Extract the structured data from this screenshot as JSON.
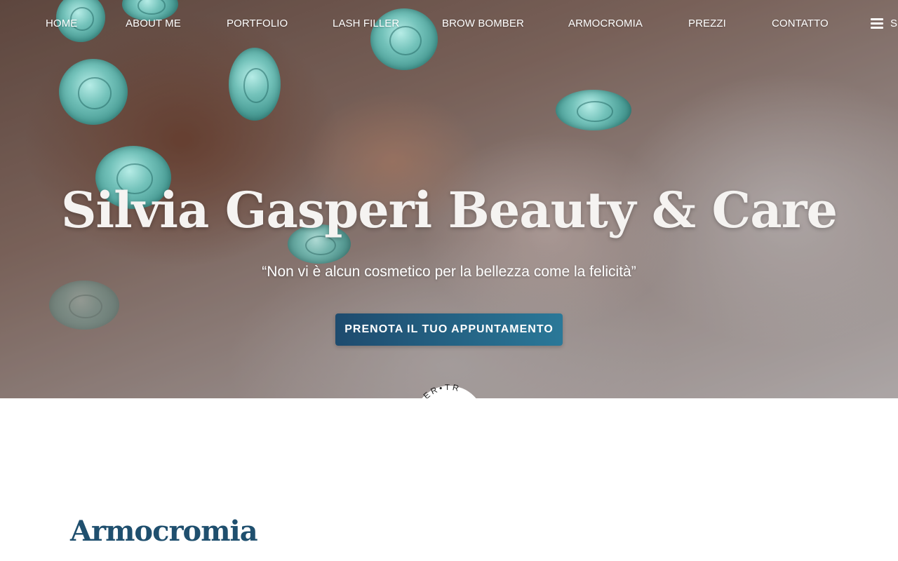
{
  "nav": {
    "items": [
      {
        "label": "HOME"
      },
      {
        "label": "ABOUT ME"
      },
      {
        "label": "PORTFOLIO"
      },
      {
        "label": "LASH FILLER"
      },
      {
        "label": "BROW BOMBER"
      },
      {
        "label": "ARMOCROMIA"
      },
      {
        "label": "PREZZI"
      },
      {
        "label": "CONTATTO"
      }
    ],
    "menu_icon": "hamburger-menu-icon",
    "menu_label": "S"
  },
  "hero": {
    "title": "Silvia Gasperi Beauty & Care",
    "quote": "“Non vi è alcun cosmetico per la bellezza come la felicità”",
    "cta_label": "PRENOTA IL TUO APPUNTAMENTO",
    "badge_text": "ER•TR",
    "colors": {
      "cta_start": "#1e4b6e",
      "cta_end": "#2a7898",
      "rose": "#73c2ba"
    }
  },
  "section": {
    "heading": "Armocromia",
    "heading_color": "#1f4f6e"
  }
}
